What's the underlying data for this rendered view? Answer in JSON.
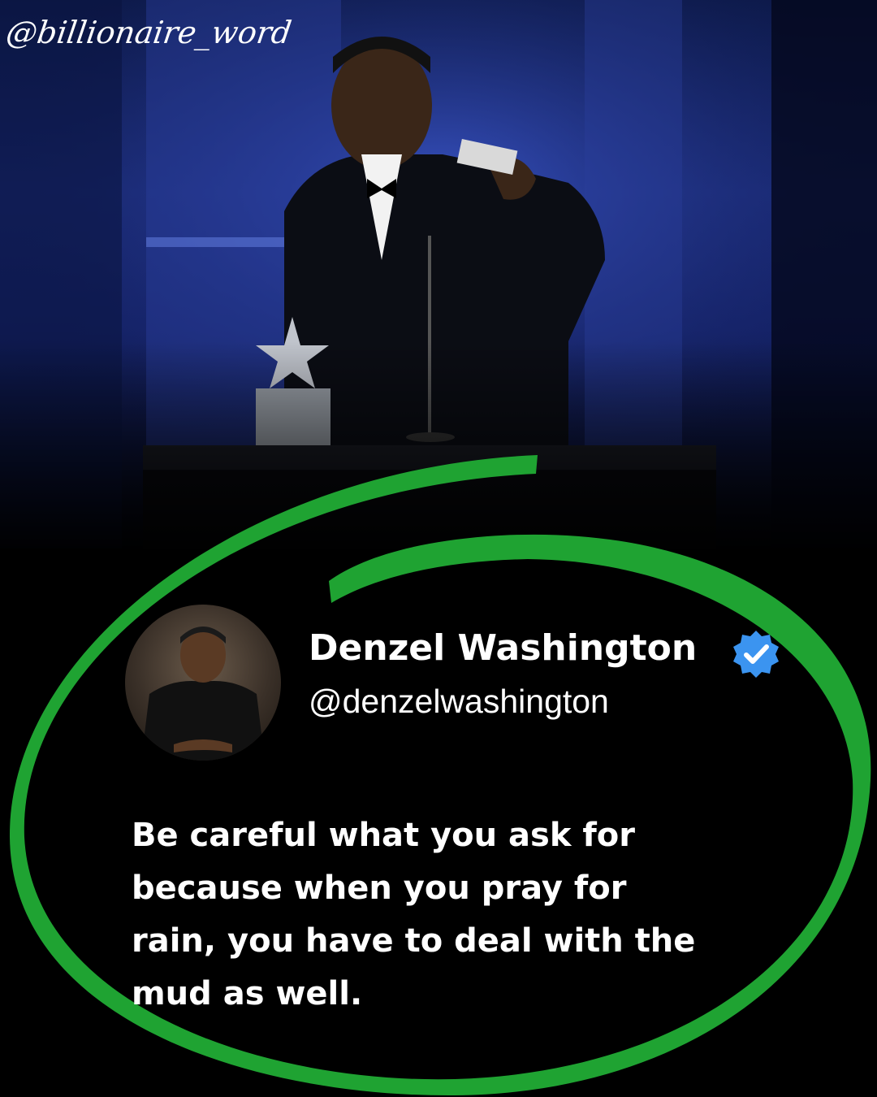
{
  "watermark": "@billionaire_word",
  "profile": {
    "name": "Denzel Washington",
    "handle": "@denzelwashington",
    "verified_icon": "verified-badge-icon"
  },
  "quote": {
    "text": "Be careful what you ask for because when you pray for rain, you have to deal with the mud as well."
  },
  "colors": {
    "background": "#000000",
    "accent_green": "#1fa332",
    "verified_blue": "#3b94f0",
    "stage_blue": "#1b2c7a"
  }
}
